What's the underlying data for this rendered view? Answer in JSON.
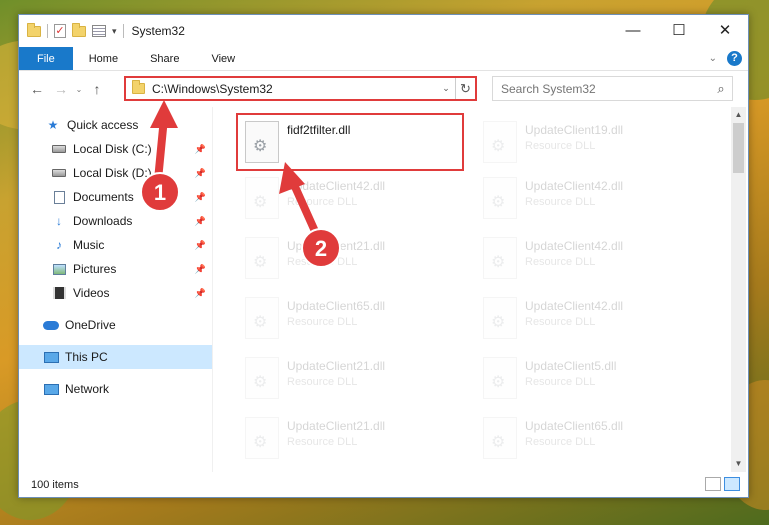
{
  "window": {
    "title": "System32"
  },
  "ribbon": {
    "tabs": [
      "File",
      "Home",
      "Share",
      "View"
    ]
  },
  "address": {
    "path": "C:\\Windows\\System32"
  },
  "search": {
    "placeholder": "Search System32"
  },
  "sidebar": {
    "items": [
      {
        "label": "Quick access",
        "icon": "star-icon"
      },
      {
        "label": "Local Disk (C:)",
        "icon": "drive-icon",
        "pinned": true
      },
      {
        "label": "Local Disk (D:)",
        "icon": "drive-icon",
        "pinned": true
      },
      {
        "label": "Documents",
        "icon": "document-icon",
        "pinned": true
      },
      {
        "label": "Downloads",
        "icon": "download-icon",
        "pinned": true
      },
      {
        "label": "Music",
        "icon": "music-icon",
        "pinned": true
      },
      {
        "label": "Pictures",
        "icon": "pictures-icon",
        "pinned": true
      },
      {
        "label": "Videos",
        "icon": "videos-icon",
        "pinned": true
      },
      {
        "label": "OneDrive",
        "icon": "cloud-icon"
      },
      {
        "label": "This PC",
        "icon": "computer-icon",
        "selected": true
      },
      {
        "label": "Network",
        "icon": "network-icon"
      }
    ]
  },
  "files": {
    "highlighted": {
      "name": "fidf2tfilter.dll",
      "type": ""
    },
    "left": [
      {
        "name": "UpdateClient42.dll",
        "type": "Resource DLL"
      },
      {
        "name": "UpdateClient21.dll",
        "type": "Resource DLL"
      },
      {
        "name": "UpdateClient65.dll",
        "type": "Resource DLL"
      },
      {
        "name": "UpdateClient21.dll",
        "type": "Resource DLL"
      },
      {
        "name": "UpdateClient21.dll",
        "type": "Resource DLL"
      }
    ],
    "right": [
      {
        "name": "UpdateClient19.dll",
        "type": "Resource DLL"
      },
      {
        "name": "UpdateClient42.dll",
        "type": "Resource DLL"
      },
      {
        "name": "UpdateClient42.dll",
        "type": "Resource DLL"
      },
      {
        "name": "UpdateClient42.dll",
        "type": "Resource DLL"
      },
      {
        "name": "UpdateClient5.dll",
        "type": "Resource DLL"
      },
      {
        "name": "UpdateClient65.dll",
        "type": "Resource DLL"
      }
    ]
  },
  "status": {
    "item_count": "100 items"
  },
  "annotations": {
    "step1": "1",
    "step2": "2"
  },
  "colors": {
    "accent": "#1979ca",
    "highlight": "#e03b3b",
    "selected": "#cce8ff"
  }
}
